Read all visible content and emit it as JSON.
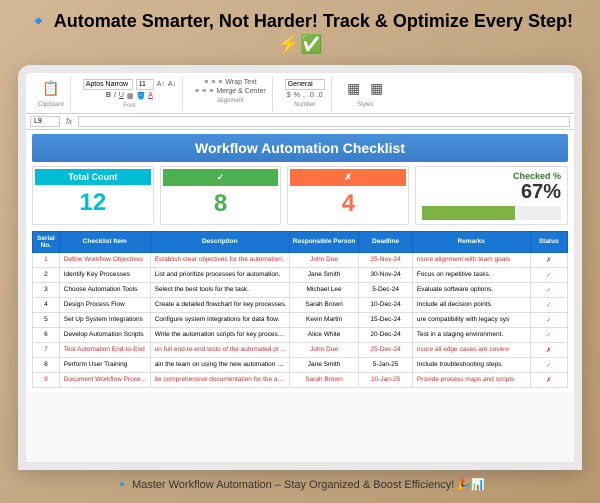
{
  "hero": {
    "prefix": "🔹",
    "title": "Automate Smarter, Not Harder! Track & Optimize Every Step! ⚡✅"
  },
  "ribbon": {
    "font_name": "Aptos Narrow",
    "font_size": "11",
    "group_clipboard": "Clipboard",
    "group_font": "Font",
    "group_alignment": "Alignment",
    "group_number": "Number",
    "group_styles": "Styles",
    "wrap_text": "Wrap Text",
    "merge_center": "Merge & Center",
    "number_format": "General",
    "cond_fmt": "Conditional Formatting",
    "fmt_table": "Format as Table",
    "paste": "Paste"
  },
  "formula": {
    "cell_ref": "L9",
    "fx_label": "fx"
  },
  "sheet": {
    "title": "Workflow Automation Checklist"
  },
  "kpi": {
    "total_label": "Total Count",
    "total_value": "12",
    "checked_label": "✓",
    "checked_value": "8",
    "unchecked_label": "✗",
    "unchecked_value": "4",
    "pct_label": "Checked %",
    "pct_value": "67%"
  },
  "columns": {
    "sn": "Serial No.",
    "item": "Checklist Item",
    "desc": "Description",
    "person": "Responsible Person",
    "deadline": "Deadline",
    "remarks": "Remarks",
    "status": "Status"
  },
  "chart_data": {
    "type": "table",
    "title": "Workflow Automation Checklist",
    "summary": {
      "total": 12,
      "checked": 8,
      "unchecked": 4,
      "checked_pct": 67
    },
    "columns": [
      "Serial No.",
      "Checklist Item",
      "Description",
      "Responsible Person",
      "Deadline",
      "Remarks",
      "Status"
    ],
    "rows": [
      {
        "sn": "1",
        "item": "Define Workflow Objectives",
        "desc": "Establish clear objectives for the automation.",
        "person": "John Doe",
        "deadline": "25-Nov-24",
        "remarks": "nsure alignment with team goals",
        "status": "✗",
        "flag": "red"
      },
      {
        "sn": "2",
        "item": "Identify Key Processes",
        "desc": "List and prioritize processes for automation.",
        "person": "Jane Smith",
        "deadline": "30-Nov-24",
        "remarks": "Focus on repetitive tasks.",
        "status": "✓",
        "flag": "ok"
      },
      {
        "sn": "3",
        "item": "Choose Automation Tools",
        "desc": "Select the best tools for the task.",
        "person": "Michael Lee",
        "deadline": "5-Dec-24",
        "remarks": "Evaluate software options.",
        "status": "✓",
        "flag": "ok"
      },
      {
        "sn": "4",
        "item": "Design Process Flow",
        "desc": "Create a detailed flowchart for key processes.",
        "person": "Sarah Brown",
        "deadline": "10-Dec-24",
        "remarks": "Include all decision points.",
        "status": "✓",
        "flag": "ok"
      },
      {
        "sn": "5",
        "item": "Set Up System Integrations",
        "desc": "Configure system integrations for data flow.",
        "person": "Kevin Martin",
        "deadline": "15-Dec-24",
        "remarks": "ure compatibility with legacy sys",
        "status": "✓",
        "flag": "ok"
      },
      {
        "sn": "6",
        "item": "Develop Automation Scripts",
        "desc": "Write the automation scripts for key processes.",
        "person": "Alice White",
        "deadline": "20-Dec-24",
        "remarks": "Test in a staging environment.",
        "status": "✓",
        "flag": "ok"
      },
      {
        "sn": "7",
        "item": "Test Automation End-to-End",
        "desc": "un full end-to-end tests of the automated process",
        "person": "John Doe",
        "deadline": "25-Dec-24",
        "remarks": "nsure all edge cases are covere",
        "status": "✗",
        "flag": "red"
      },
      {
        "sn": "8",
        "item": "Perform User Training",
        "desc": "ain the team on using the new automation syster",
        "person": "Jane Smith",
        "deadline": "5-Jan-25",
        "remarks": "Include troubleshooting steps.",
        "status": "✓",
        "flag": "ok"
      },
      {
        "sn": "9",
        "item": "Document Workflow Processes",
        "desc": "ite comprehensive documentation for the automat",
        "person": "Sarah Brown",
        "deadline": "10-Jan-25",
        "remarks": "Provide process maps and scripts",
        "status": "✗",
        "flag": "red"
      }
    ]
  },
  "footer": {
    "prefix": "🔹",
    "text": "Master Workflow Automation – Stay Organized & Boost Efficiency! 🎉📊"
  }
}
